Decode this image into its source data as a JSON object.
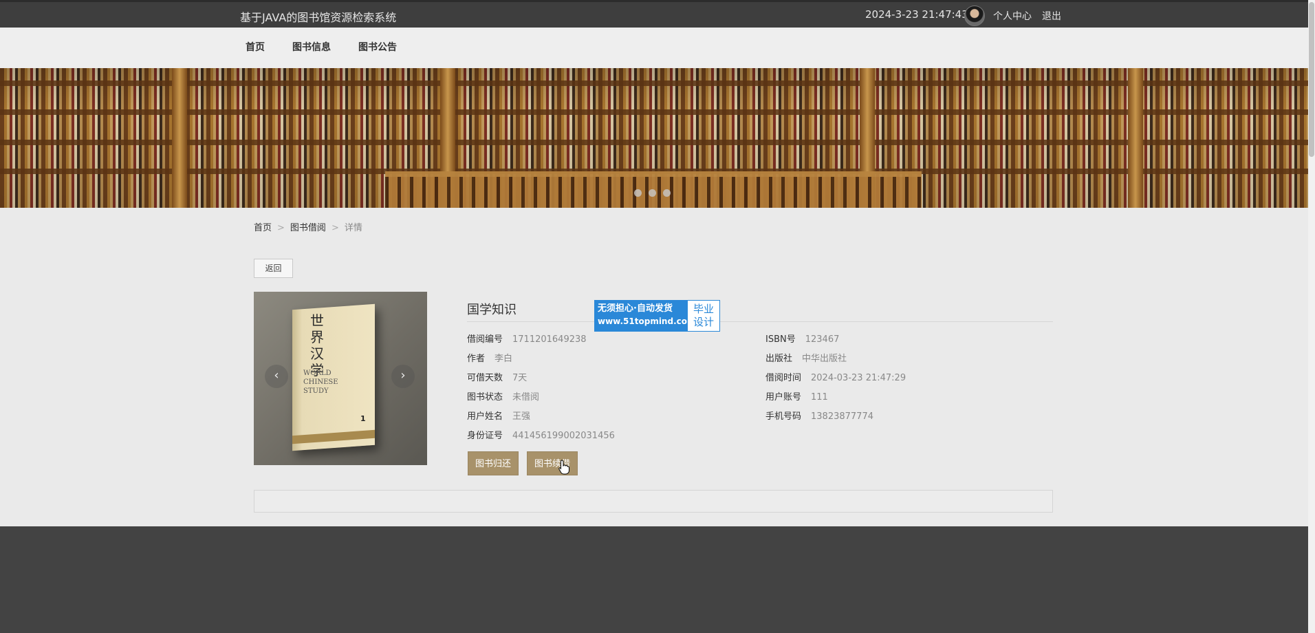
{
  "header": {
    "system_title": "基于JAVA的图书馆资源检索系统",
    "datetime": "2024-3-23 21:47:43",
    "user_center": "个人中心",
    "logout": "退出"
  },
  "nav": {
    "items": [
      "首页",
      "图书信息",
      "图书公告"
    ]
  },
  "banner": {
    "slide_count": 3,
    "active_slide": 1
  },
  "breadcrumb": {
    "home": "首页",
    "section": "图书借阅",
    "current": "详情",
    "separator": ">"
  },
  "back_label": "返回",
  "book": {
    "title": "国学知识",
    "cover_title": "世界汉学",
    "cover_subtitle": "WORLD CHINESE STUDY",
    "cover_issue": "1",
    "prev_arrow": "‹",
    "next_arrow": "›"
  },
  "details": {
    "left": [
      {
        "label": "借阅编号",
        "value": "1711201649238"
      },
      {
        "label": "作者",
        "value": "李白"
      },
      {
        "label": "可借天数",
        "value": "7天"
      },
      {
        "label": "图书状态",
        "value": "未借阅"
      },
      {
        "label": "用户姓名",
        "value": "王强"
      },
      {
        "label": "身份证号",
        "value": "441456199002031456"
      }
    ],
    "right": [
      {
        "label": "ISBN号",
        "value": "123467"
      },
      {
        "label": "出版社",
        "value": "中华出版社"
      },
      {
        "label": "借阅时间",
        "value": "2024-03-23 21:47:29"
      },
      {
        "label": "用户账号",
        "value": "111"
      },
      {
        "label": "手机号码",
        "value": "13823877774"
      }
    ]
  },
  "actions": {
    "return_label": "图书归还",
    "renew_label": "图书续借"
  },
  "watermark": {
    "line1": "无须担心·自动发货",
    "line2": "www.51topmind.com",
    "right_line1": "毕业",
    "right_line2": "设计"
  },
  "colors": {
    "topbar_bg": "#3e3e3e",
    "accent_button": "#a8926a",
    "footer_bg": "#434343",
    "watermark_blue": "#2a88d8"
  }
}
